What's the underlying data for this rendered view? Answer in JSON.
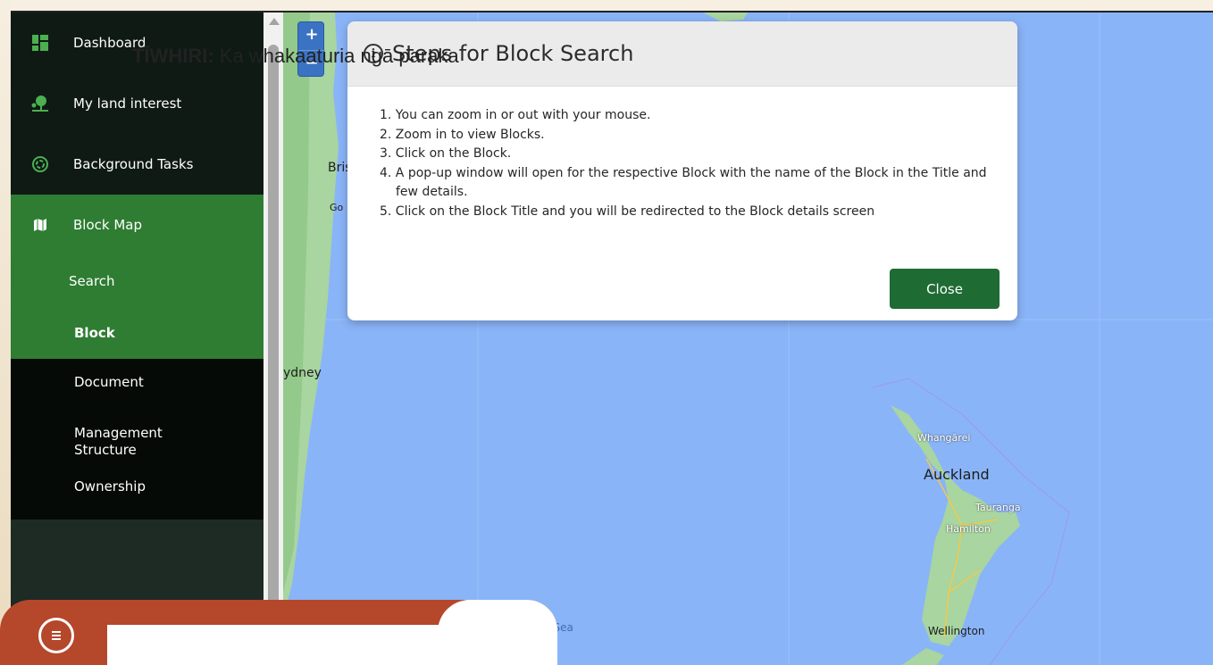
{
  "sidebar": {
    "items": [
      {
        "label": "Dashboard",
        "icon": "dashboard-icon"
      },
      {
        "label": "My land interest",
        "icon": "tree-icon"
      },
      {
        "label": "Background Tasks",
        "icon": "spinner-icon"
      },
      {
        "label": "Block Map",
        "icon": "map-icon"
      }
    ],
    "sub_items": [
      {
        "label": "Search"
      },
      {
        "label": "Block"
      },
      {
        "label": "Document"
      },
      {
        "label": "Management Structure"
      },
      {
        "label": "Ownership"
      }
    ]
  },
  "map": {
    "zoom_in": "+",
    "zoom_out": "−",
    "labels": {
      "brisbane": "Bris",
      "gold_coast": "Go",
      "sydney": "ydney",
      "whangarei": "Whangārei",
      "auckland": "Auckland",
      "tauranga": "Tauranga",
      "hamilton": "Hamilton",
      "tasman": "man Sea",
      "wellington": "Wellington"
    }
  },
  "modal": {
    "title": "Steps for Block Search",
    "steps": [
      "1. You can zoom in or out with your mouse.",
      "2. Zoom in to view Blocks.",
      "3. Click on the Block.",
      "4. A pop-up window will open for the respective Block with the name of the Block in the Title and few details.",
      "5. Click on the Block Title and you will be redirected to the Block details screen"
    ],
    "close_label": "Close"
  },
  "tip": {
    "text": "TĪWHIRI: Ka whakaaturia ngā paraka"
  },
  "colors": {
    "sidebar_bg": "#0f1a15",
    "active_green": "#2e7d32",
    "close_button": "#1e6b34",
    "tip_red": "#b5472b",
    "map_water": "#8ab4f8",
    "map_land": "#a8d5a0"
  }
}
